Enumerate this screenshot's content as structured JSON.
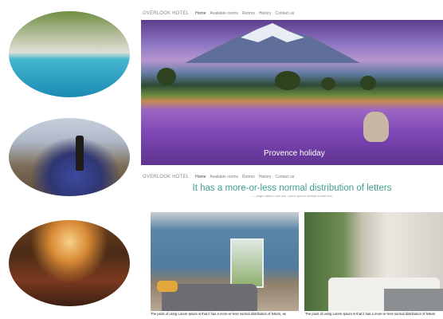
{
  "nav": {
    "brand": "OVERLOOK HOTEL",
    "links": [
      "Home",
      "Available rooms",
      "Rooms",
      "History",
      "Contact us"
    ],
    "active": "Home"
  },
  "hero": {
    "caption": "Provence holiday"
  },
  "section": {
    "heading": "It has a more-or-less normal distribution of letters",
    "subheading": "— page editors now use Lorem Ipsum default model text"
  },
  "rooms": [
    {
      "caption": "The point of using Lorem Ipsum is that it has a more-or-less normal distribution of letters, as"
    },
    {
      "caption": "The point of using Lorem Ipsum is that it has a more-or-less normal distribution of letters"
    }
  ],
  "colors": {
    "accent": "#3fa08a",
    "nav_text": "#7c7c7c"
  }
}
